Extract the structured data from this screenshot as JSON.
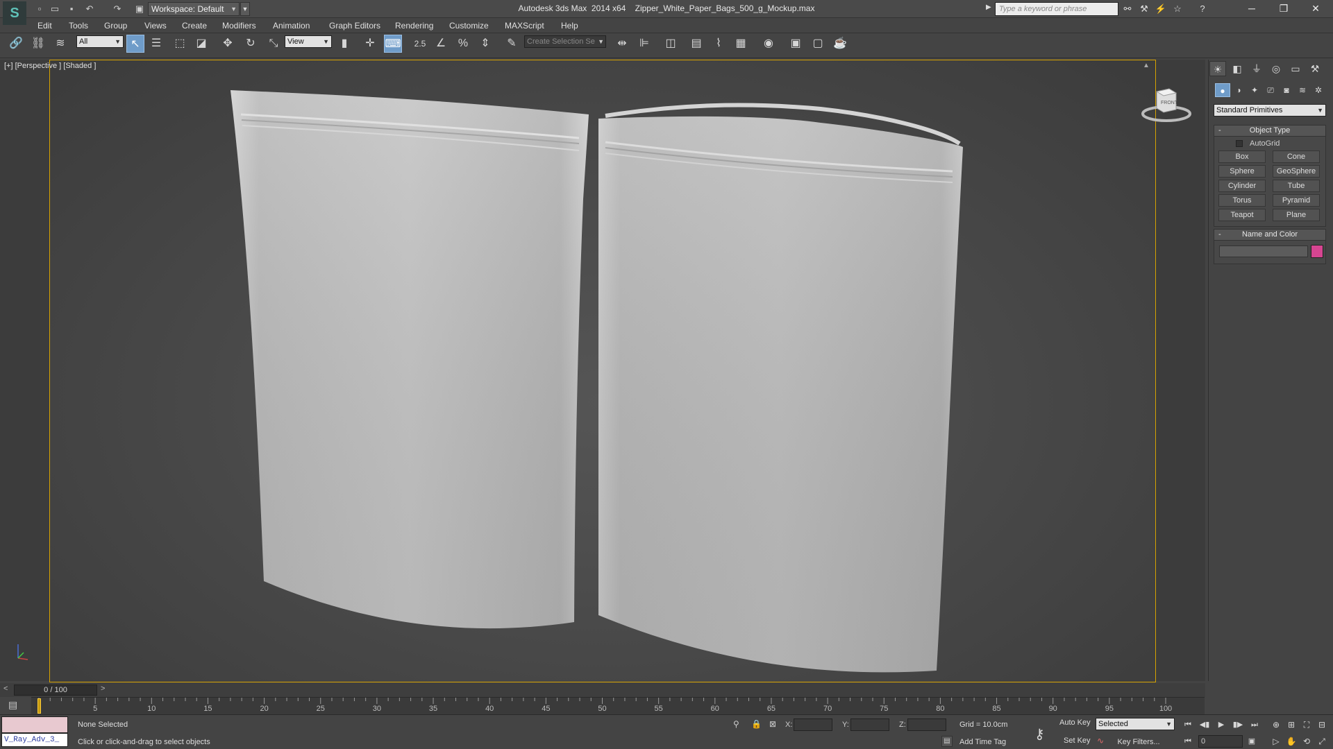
{
  "app": {
    "title": "Autodesk 3ds Max  2014 x64    Zipper_White_Paper_Bags_500_g_Mockup.max",
    "workspace": "Workspace: Default",
    "search_placeholder": "Type a keyword or phrase"
  },
  "menu": [
    "Edit",
    "Tools",
    "Group",
    "Views",
    "Create",
    "Modifiers",
    "Animation",
    "Graph Editors",
    "Rendering",
    "Customize",
    "MAXScript",
    "Help"
  ],
  "toolbar": {
    "filter_value": "All",
    "ref_coord_value": "View",
    "snap_value": "2.5",
    "selection_set_placeholder": "Create Selection Se"
  },
  "viewport": {
    "label": "[+] [Perspective ] [Shaded ]",
    "viewcube_face": "FRONT"
  },
  "command_panel": {
    "category": "Standard Primitives",
    "object_type_title": "Object Type",
    "autogrid_label": "AutoGrid",
    "primitives": [
      "Box",
      "Cone",
      "Sphere",
      "GeoSphere",
      "Cylinder",
      "Tube",
      "Torus",
      "Pyramid",
      "Teapot",
      "Plane"
    ],
    "name_color_title": "Name and Color",
    "object_color": "#d64591"
  },
  "timeline": {
    "frame_display": "0 / 100",
    "ticks": [
      "5",
      "10",
      "15",
      "20",
      "25",
      "30",
      "35",
      "40",
      "45",
      "50",
      "55",
      "60",
      "65",
      "70",
      "75",
      "80",
      "85",
      "90",
      "95",
      "100"
    ]
  },
  "status": {
    "maxscript_listener": "V_Ray_Adv_3_",
    "selection": "None Selected",
    "prompt": "Click or click-and-drag to select objects",
    "x_label": "X:",
    "y_label": "Y:",
    "z_label": "Z:",
    "grid": "Grid = 10.0cm",
    "add_time_tag": "Add Time Tag",
    "auto_key": "Auto Key",
    "set_key": "Set Key",
    "key_mode": "Selected",
    "key_filters": "Key Filters...",
    "current_frame": "0"
  },
  "colors": {
    "accent_active": "#6f9cc9",
    "viewport_border": "#d7a300"
  }
}
